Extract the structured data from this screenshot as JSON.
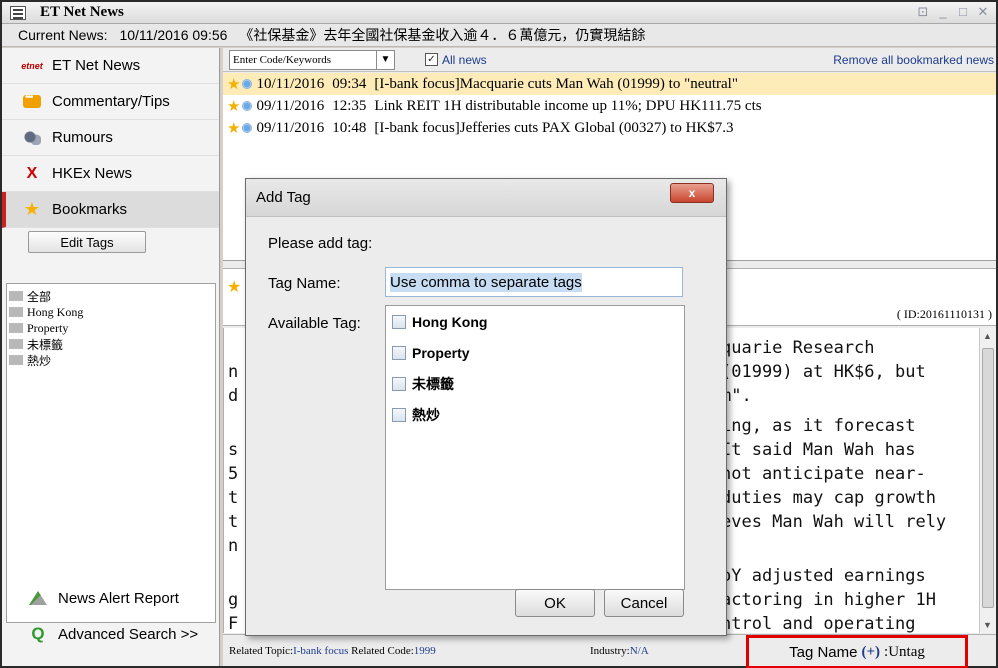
{
  "window": {
    "title": "ET Net News",
    "controls": [
      "⊡",
      "_",
      "□",
      "✕"
    ]
  },
  "ticker": {
    "label": "Current News:",
    "datetime": "10/11/2016  09:56",
    "headline": "《社保基金》去年全國社保基金收入逾４．６萬億元，仍實現結餘"
  },
  "sidebar": {
    "items": [
      {
        "label": "ET Net News",
        "icon": "etnet-icon",
        "selected": false
      },
      {
        "label": "Commentary/Tips",
        "icon": "commentary-icon",
        "selected": false
      },
      {
        "label": "Rumours",
        "icon": "rumours-icon",
        "selected": false
      },
      {
        "label": "HKEx News",
        "icon": "hkex-icon",
        "selected": false
      },
      {
        "label": "Bookmarks",
        "icon": "star-icon",
        "selected": true
      }
    ],
    "edit_tags_label": "Edit Tags",
    "tag_tree": [
      "全部",
      "Hong Kong",
      "Property",
      "未標籤",
      "熱炒"
    ],
    "bottom_items": [
      {
        "label": "News Alert Report",
        "icon": "alert-icon"
      },
      {
        "label": "Advanced Search >>",
        "icon": "search-icon"
      }
    ],
    "accent_color": "#cc2222"
  },
  "toolbar": {
    "search_value": "Enter Code/Keywords",
    "all_news_label": "All news",
    "all_news_checked": true,
    "remove_link": "Remove all bookmarked news"
  },
  "news": [
    {
      "date": "10/11/2016",
      "time": "09:34",
      "headline": "[I-bank focus]Macquarie cuts Man Wah (01999) to \"neutral\"",
      "selected": true
    },
    {
      "date": "09/11/2016",
      "time": "12:35",
      "headline": "Link REIT 1H distributable income up 11%; DPU HK111.75 cts",
      "selected": false
    },
    {
      "date": "09/11/2016",
      "time": "10:48",
      "headline": "[I-bank focus]Jefferies cuts PAX Global (00327) to HK$7.3",
      "selected": false
    }
  ],
  "detail": {
    "id_text": "( ID:20161110131 )"
  },
  "article": {
    "lines": [
      {
        "left": "",
        "right": "quarie Research"
      },
      {
        "left": "n",
        "right": "(01999) at HK$6, but"
      },
      {
        "left": "d",
        "right": "m\"."
      },
      {
        "left": "",
        "right": "ing, as it forecast"
      },
      {
        "left": "s",
        "right": " It said Man Wah has"
      },
      {
        "left": "5",
        "right": "not anticipate near-"
      },
      {
        "left": "t",
        "right": "duties may cap growth"
      },
      {
        "left": "t",
        "right": "eves Man Wah will rely"
      },
      {
        "left": "n",
        "right": ""
      },
      {
        "left": "",
        "right": "oY adjusted earnings"
      },
      {
        "left": "g",
        "right": "actoring in higher 1H"
      },
      {
        "left": "F",
        "right": "ntrol and operating"
      }
    ]
  },
  "status": {
    "related_topic_label": "Related Topic:",
    "related_topic": "I-bank focus",
    "related_code_label": " Related Code:",
    "related_code": "1999",
    "industry_label": "Industry:",
    "industry": "N/A",
    "tag_name_label": "Tag Name",
    "tag_plus": "(+)",
    "tag_value": ":Untag",
    "highlight_color": "#e00000"
  },
  "dialog": {
    "title": "Add Tag",
    "close_label": "x",
    "prompt": "Please add tag:",
    "tag_name_label": "Tag Name:",
    "tag_name_placeholder": "Use comma to separate tags",
    "available_label": "Available Tag:",
    "available_tags": [
      {
        "label": "Hong Kong",
        "checked": false
      },
      {
        "label": "Property",
        "checked": false
      },
      {
        "label": "未標籤",
        "checked": false
      },
      {
        "label": "熱炒",
        "checked": false
      }
    ],
    "ok_label": "OK",
    "cancel_label": "Cancel"
  }
}
